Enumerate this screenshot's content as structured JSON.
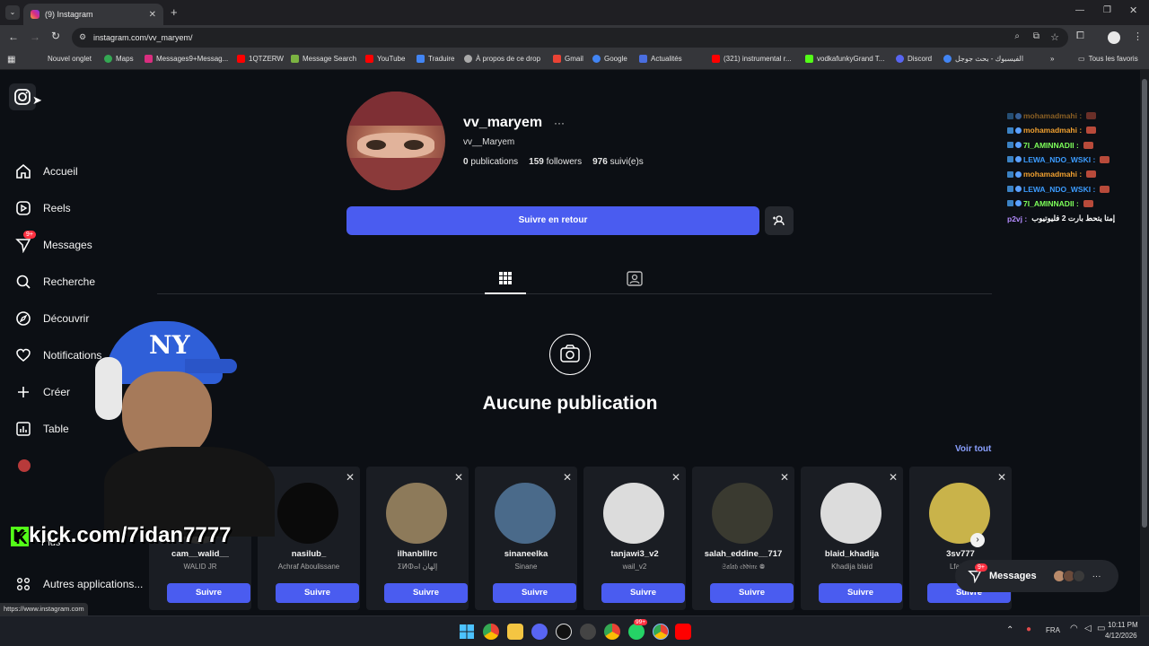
{
  "browser": {
    "tab_title": "(9) Instagram",
    "url": "instagram.com/vv_maryem/",
    "bookmarks": [
      "Nouvel onglet",
      "Maps",
      "Messages9+Messag...",
      "1QTZERW",
      "Message Search",
      "YouTube",
      "Traduire",
      "À propos de ce drop",
      "Gmail",
      "Google",
      "Actualités",
      "(321) instrumental r...",
      "vodkafunkyGrand T...",
      "Discord",
      "الفيسبوك - بحث جوجل"
    ],
    "bookmarks_all": "Tous les favoris",
    "status_url": "https://www.instagram.com"
  },
  "sidebar": {
    "items": [
      {
        "label": "Accueil",
        "icon": "home-icon"
      },
      {
        "label": "Reels",
        "icon": "reels-icon"
      },
      {
        "label": "Messages",
        "icon": "messages-icon",
        "badge": "9+"
      },
      {
        "label": "Recherche",
        "icon": "search-icon"
      },
      {
        "label": "Découvrir",
        "icon": "explore-icon"
      },
      {
        "label": "Notifications",
        "icon": "heart-icon"
      },
      {
        "label": "Créer",
        "icon": "plus-icon"
      },
      {
        "label": "Table",
        "icon": "dashboard-icon"
      }
    ],
    "more_label": "Plus",
    "other_apps_label": "Autres applications..."
  },
  "profile": {
    "username": "vv_maryem",
    "display_name": "vv__Maryem",
    "posts_count": "0",
    "posts_label": "publications",
    "followers_count": "159",
    "followers_label": "followers",
    "following_count": "976",
    "following_label": "suivi(e)s",
    "follow_back_label": "Suivre en retour",
    "empty_title": "Aucune publication"
  },
  "suggestions": {
    "see_all_label": "Voir tout",
    "follow_label": "Suivre",
    "cards": [
      {
        "name": "cam__walid__",
        "sub": "WALID JR",
        "color": "#2a2a2a"
      },
      {
        "name": "nasilub_",
        "sub": "Achraf Aboulissane",
        "color": "#0a0a0a"
      },
      {
        "name": "ilhanblllrc",
        "sub": "ⵉⵍⵀⴰⵏ إلهان",
        "color": "#8d7a5a"
      },
      {
        "name": "sinaneelka",
        "sub": "Sinane",
        "color": "#4a6a8a"
      },
      {
        "name": "tanjawi3_v2",
        "sub": "wail_v2",
        "color": "#dcdcdc"
      },
      {
        "name": "salah_eddine__717",
        "sub": "𝔖𝔞𝔩𝔞𝔥 𝔢𝔡𝔡𝔦𝔫𝔢 ❁",
        "color": "#3a3a30"
      },
      {
        "name": "blaid_khadija",
        "sub": "Khadija blaid",
        "color": "#dcdcdc"
      },
      {
        "name": "3sv777",
        "sub": "Lfata c",
        "color": "#c9b34a"
      }
    ]
  },
  "messages_widget": {
    "label": "Messages",
    "badge": "9+"
  },
  "stream": {
    "overlay_text": "kick.com/7idan7777",
    "chat": [
      {
        "user": "mohamadmahi :",
        "color": "#f0a030",
        "faded": true
      },
      {
        "user": "mohamadmahi :",
        "color": "#f0a030"
      },
      {
        "user": "7I_AMINNADII :",
        "color": "#7dff5a"
      },
      {
        "user": "LEWA_NDO_WSKI :",
        "color": "#3c9cff"
      },
      {
        "user": "mohamadmahi :",
        "color": "#f0a030"
      },
      {
        "user": "LEWA_NDO_WSKI :",
        "color": "#3c9cff"
      },
      {
        "user": "7I_AMINNADII :",
        "color": "#7dff5a"
      },
      {
        "user": "p2vj :",
        "color": "#b48cff",
        "text": "إمتا يتحط بارت 2 فليوتيوب"
      }
    ]
  },
  "taskbar": {
    "lang": "FRA",
    "time": "10:11 PM",
    "date": "4/12/2026",
    "badge": "99+"
  }
}
